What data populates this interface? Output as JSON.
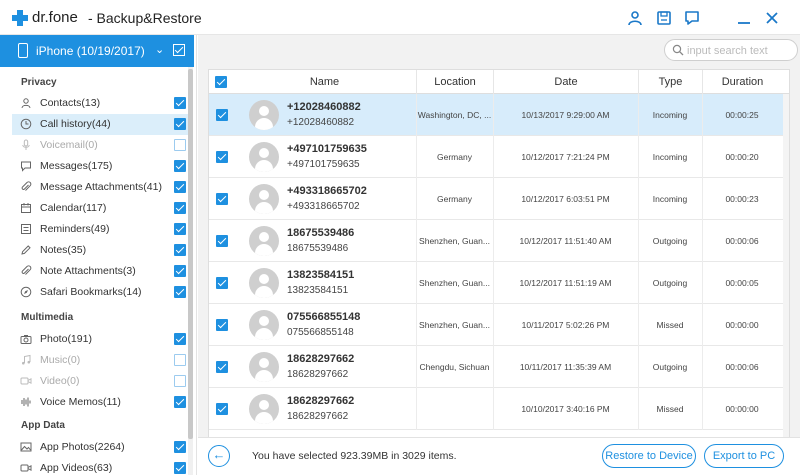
{
  "app": {
    "logo_text": "dr.fone",
    "title": "- Backup&Restore"
  },
  "titlebar_icons": [
    "user-icon",
    "save-icon",
    "chat-icon",
    "minimize-icon",
    "close-icon"
  ],
  "device": {
    "label": "iPhone (10/19/2017)",
    "checked": true
  },
  "sidebar": {
    "sections": [
      {
        "title": "Privacy",
        "items": [
          {
            "label": "Contacts(13)",
            "icon": "contacts-icon",
            "checked": true
          },
          {
            "label": "Call history(44)",
            "icon": "clock-icon",
            "checked": true,
            "active": true
          },
          {
            "label": "Voicemail(0)",
            "icon": "mic-icon",
            "checked": false,
            "disabled": true
          },
          {
            "label": "Messages(175)",
            "icon": "message-icon",
            "checked": true
          },
          {
            "label": "Message Attachments(41)",
            "icon": "paperclip-icon",
            "checked": true
          },
          {
            "label": "Calendar(117)",
            "icon": "calendar-icon",
            "checked": true
          },
          {
            "label": "Reminders(49)",
            "icon": "list-icon",
            "checked": true
          },
          {
            "label": "Notes(35)",
            "icon": "pencil-icon",
            "checked": true
          },
          {
            "label": "Note Attachments(3)",
            "icon": "paperclip-icon",
            "checked": true
          },
          {
            "label": "Safari Bookmarks(14)",
            "icon": "compass-icon",
            "checked": true
          }
        ]
      },
      {
        "title": "Multimedia",
        "items": [
          {
            "label": "Photo(191)",
            "icon": "camera-icon",
            "checked": true
          },
          {
            "label": "Music(0)",
            "icon": "music-icon",
            "checked": false,
            "disabled": true
          },
          {
            "label": "Video(0)",
            "icon": "video-icon",
            "checked": false,
            "disabled": true
          },
          {
            "label": "Voice Memos(11)",
            "icon": "waveform-icon",
            "checked": true
          }
        ]
      },
      {
        "title": "App Data",
        "items": [
          {
            "label": "App Photos(2264)",
            "icon": "image-icon",
            "checked": true
          },
          {
            "label": "App Videos(63)",
            "icon": "video-icon",
            "checked": true
          }
        ]
      }
    ]
  },
  "search": {
    "placeholder": "input search text",
    "value": ""
  },
  "table": {
    "headers": [
      "Name",
      "Location",
      "Date",
      "Type",
      "Duration"
    ],
    "rows": [
      {
        "name": "+12028460882",
        "number": "+12028460882",
        "location": "Washington, DC, ...",
        "date": "10/13/2017 9:29:00 AM",
        "type": "Incoming",
        "duration": "00:00:25",
        "selected": true
      },
      {
        "name": "+497101759635",
        "number": "+497101759635",
        "location": "Germany",
        "date": "10/12/2017 7:21:24 PM",
        "type": "Incoming",
        "duration": "00:00:20",
        "selected": false
      },
      {
        "name": "+493318665702",
        "number": "+493318665702",
        "location": "Germany",
        "date": "10/12/2017 6:03:51 PM",
        "type": "Incoming",
        "duration": "00:00:23",
        "selected": false
      },
      {
        "name": "18675539486",
        "number": "18675539486",
        "location": "Shenzhen, Guan...",
        "date": "10/12/2017 11:51:40 AM",
        "type": "Outgoing",
        "duration": "00:00:06",
        "selected": false
      },
      {
        "name": "13823584151",
        "number": "13823584151",
        "location": "Shenzhen, Guan...",
        "date": "10/12/2017 11:51:19 AM",
        "type": "Outgoing",
        "duration": "00:00:05",
        "selected": false
      },
      {
        "name": "075566855148",
        "number": "075566855148",
        "location": "Shenzhen, Guan...",
        "date": "10/11/2017 5:02:26 PM",
        "type": "Missed",
        "duration": "00:00:00",
        "selected": false
      },
      {
        "name": "18628297662",
        "number": "18628297662",
        "location": "Chengdu, Sichuan",
        "date": "10/11/2017 11:35:39 AM",
        "type": "Outgoing",
        "duration": "00:00:06",
        "selected": false
      },
      {
        "name": "18628297662",
        "number": "18628297662",
        "location": "",
        "date": "10/10/2017 3:40:16 PM",
        "type": "Missed",
        "duration": "00:00:00",
        "selected": false
      }
    ]
  },
  "footer": {
    "status": "You have selected 923.39MB in 3029 items.",
    "restore_label": "Restore to Device",
    "export_label": "Export to PC"
  },
  "colors": {
    "accent": "#1e90e0",
    "selected_row": "#d7ecfb"
  }
}
